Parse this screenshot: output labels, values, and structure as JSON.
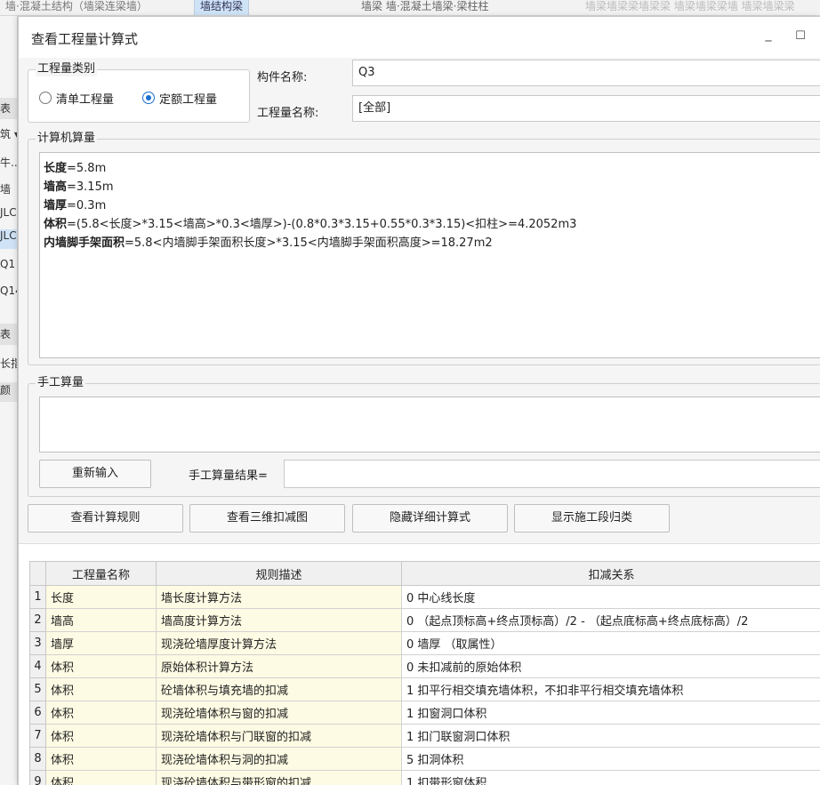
{
  "background": {
    "tabs": [
      "墙·混凝土结构（墙梁连梁墙）",
      "墙结构梁",
      "墙梁 墙·混凝土墙梁·梁柱柱",
      "墙梁墙梁梁墙梁梁 墙梁墙梁梁墙 墙梁墙梁梁"
    ],
    "sidebar": [
      "表",
      "筑 ▾",
      "牛...",
      "墙",
      "JLC",
      "JLC",
      "Q1",
      "Q14",
      "表",
      "长指",
      "颜"
    ]
  },
  "dialog": {
    "title": "查看工程量计算式",
    "minimize_glyph": "_",
    "maximize_glyph": "☐"
  },
  "quantity_type": {
    "legend": "工程量类别",
    "options": [
      {
        "label": "清单工程量",
        "selected": false
      },
      {
        "label": "定额工程量",
        "selected": true
      }
    ]
  },
  "component": {
    "name_label": "构件名称:",
    "name_value": "Q3",
    "quantity_label": "工程量名称:",
    "quantity_value": "[全部]"
  },
  "computer_calc": {
    "legend": "计算机算量",
    "lines": [
      {
        "key": "长度",
        "rest": "=5.8m"
      },
      {
        "key": "墙高",
        "rest": "=3.15m"
      },
      {
        "key": "墙厚",
        "rest": "=0.3m"
      },
      {
        "key": "体积",
        "rest": "=(5.8<长度>*3.15<墙高>*0.3<墙厚>)-(0.8*0.3*3.15+0.55*0.3*3.15)<扣柱>=4.2052m3"
      },
      {
        "key": "内墙脚手架面积",
        "rest": "=5.8<内墙脚手架面积长度>*3.15<内墙脚手架面积高度>=18.27m2"
      }
    ]
  },
  "manual_calc": {
    "legend": "手工算量",
    "reinput_button": "重新输入",
    "result_label": "手工算量结果=",
    "result_value": ""
  },
  "actions": {
    "view_rules": "查看计算规则",
    "view_3d": "查看三维扣减图",
    "hide_detail": "隐藏详细计算式",
    "show_section": "显示施工段归类"
  },
  "rules_table": {
    "headers": [
      "",
      "工程量名称",
      "规则描述",
      "扣减关系"
    ],
    "rows": [
      {
        "idx": "1",
        "name": "长度",
        "desc": "墙长度计算方法",
        "relation": "0 中心线长度"
      },
      {
        "idx": "2",
        "name": "墙高",
        "desc": "墙高度计算方法",
        "relation": "0 （起点顶标高+终点顶标高）/2 - （起点底标高+终点底标高）/2"
      },
      {
        "idx": "3",
        "name": "墙厚",
        "desc": "现浇砼墙厚度计算方法",
        "relation": "0 墙厚 （取属性）"
      },
      {
        "idx": "4",
        "name": "体积",
        "desc": "原始体积计算方法",
        "relation": "0 未扣减前的原始体积"
      },
      {
        "idx": "5",
        "name": "体积",
        "desc": "砼墙体积与填充墙的扣减",
        "relation": "1 扣平行相交填充墙体积，不扣非平行相交填充墙体积"
      },
      {
        "idx": "6",
        "name": "体积",
        "desc": "现浇砼墙体积与窗的扣减",
        "relation": "1 扣窗洞口体积"
      },
      {
        "idx": "7",
        "name": "体积",
        "desc": "现浇砼墙体积与门联窗的扣减",
        "relation": "1 扣门联窗洞口体积"
      },
      {
        "idx": "8",
        "name": "体积",
        "desc": "现浇砼墙体积与洞的扣减",
        "relation": "5 扣洞体积"
      },
      {
        "idx": "9",
        "name": "体积",
        "desc": "现浇砼墙体积与带形窗的扣减",
        "relation": "1 扣带形窗体积"
      }
    ]
  }
}
